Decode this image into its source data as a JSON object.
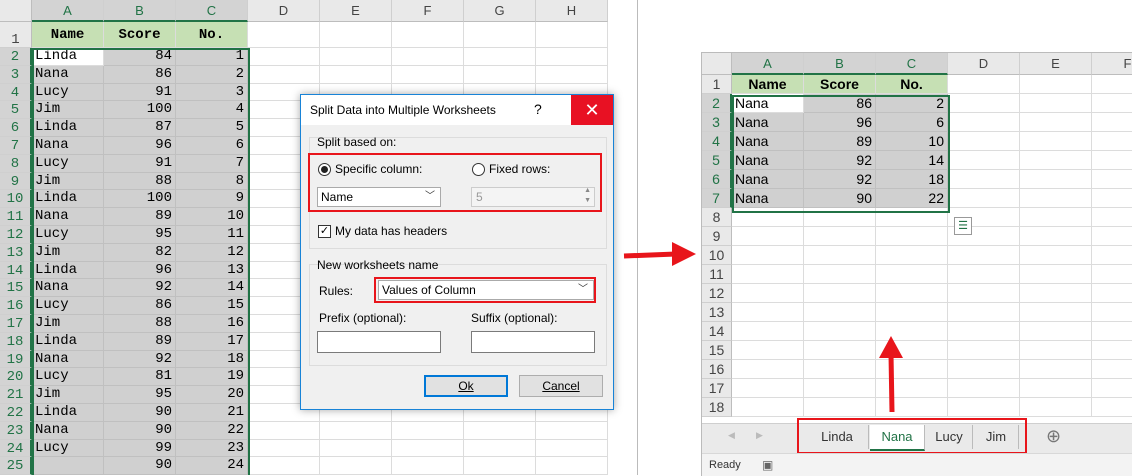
{
  "left_sheet": {
    "columns": [
      "A",
      "B",
      "C",
      "D",
      "E",
      "F",
      "G",
      "H"
    ],
    "headers": [
      "Name",
      "Score",
      "No."
    ],
    "rows": [
      [
        "Linda",
        "84",
        "1"
      ],
      [
        "Nana",
        "86",
        "2"
      ],
      [
        "Lucy",
        "91",
        "3"
      ],
      [
        "Jim",
        "100",
        "4"
      ],
      [
        "Linda",
        "87",
        "5"
      ],
      [
        "Nana",
        "96",
        "6"
      ],
      [
        "Lucy",
        "91",
        "7"
      ],
      [
        "Jim",
        "88",
        "8"
      ],
      [
        "Linda",
        "100",
        "9"
      ],
      [
        "Nana",
        "89",
        "10"
      ],
      [
        "Lucy",
        "95",
        "11"
      ],
      [
        "Jim",
        "82",
        "12"
      ],
      [
        "Linda",
        "96",
        "13"
      ],
      [
        "Nana",
        "92",
        "14"
      ],
      [
        "Lucy",
        "86",
        "15"
      ],
      [
        "Jim",
        "88",
        "16"
      ],
      [
        "Linda",
        "89",
        "17"
      ],
      [
        "Nana",
        "92",
        "18"
      ],
      [
        "Lucy",
        "81",
        "19"
      ],
      [
        "Jim",
        "95",
        "20"
      ],
      [
        "Linda",
        "90",
        "21"
      ],
      [
        "Nana",
        "90",
        "22"
      ],
      [
        "Lucy",
        "99",
        "23"
      ],
      [
        "",
        "90",
        "24"
      ]
    ]
  },
  "dialog": {
    "title": "Split Data into Multiple Worksheets",
    "help": "?",
    "close": "✕",
    "split_based_on": "Split based on:",
    "specific_column": "Specific column:",
    "fixed_rows": "Fixed rows:",
    "column_value": "Name",
    "fixed_rows_value": "5",
    "has_headers": "My data has headers",
    "new_names": "New worksheets name",
    "rules_label": "Rules:",
    "rules_value": "Values of Column",
    "prefix": "Prefix (optional):",
    "suffix": "Suffix (optional):",
    "ok": "Ok",
    "cancel": "Cancel"
  },
  "right_sheet": {
    "columns": [
      "A",
      "B",
      "C",
      "D",
      "E",
      "F"
    ],
    "headers": [
      "Name",
      "Score",
      "No."
    ],
    "rows": [
      [
        "Nana",
        "86",
        "2"
      ],
      [
        "Nana",
        "96",
        "6"
      ],
      [
        "Nana",
        "89",
        "10"
      ],
      [
        "Nana",
        "92",
        "14"
      ],
      [
        "Nana",
        "92",
        "18"
      ],
      [
        "Nana",
        "90",
        "22"
      ]
    ],
    "row_numbers": [
      "1",
      "2",
      "3",
      "4",
      "5",
      "6",
      "7",
      "8",
      "9",
      "10",
      "11",
      "12",
      "13",
      "14",
      "15",
      "16",
      "17",
      "18"
    ],
    "tabs": [
      "Linda",
      "Nana",
      "Lucy",
      "Jim"
    ],
    "active_tab": "Nana",
    "status": "Ready",
    "add_sheet": "⊕",
    "nav_prev": "◀",
    "nav_next": "▶"
  },
  "colors": {
    "accent": "#217346",
    "highlight": "#e8151b",
    "dialog_accent": "#0078d7"
  }
}
